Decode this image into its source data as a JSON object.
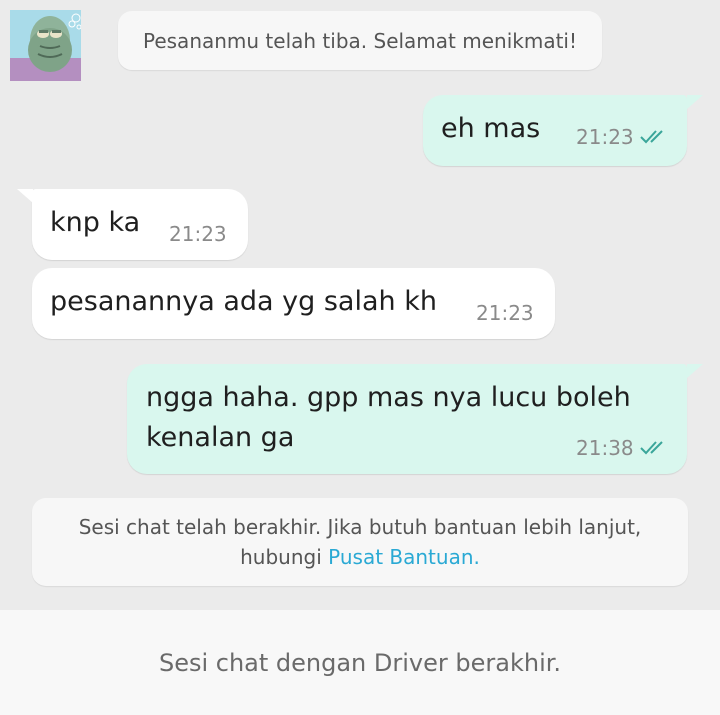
{
  "system_notice": {
    "text": "Pesananmu telah tiba. Selamat menikmati!"
  },
  "avatar": {
    "icon": "fish-character-avatar"
  },
  "messages": [
    {
      "direction": "out",
      "text": "eh mas",
      "time": "21:23",
      "status": "read"
    },
    {
      "direction": "in",
      "text": "knp ka",
      "time": "21:23"
    },
    {
      "direction": "in",
      "text": "pesanannya ada yg salah kh",
      "time": "21:23"
    },
    {
      "direction": "out",
      "text_line1": "ngga haha. gpp mas nya lucu boleh",
      "text_line2": "kenalan ga",
      "time": "21:38",
      "status": "read"
    }
  ],
  "end_notice": {
    "line1": "Sesi chat telah berakhir. Jika butuh bantuan lebih lanjut,",
    "line2_prefix": "hubungi ",
    "link_text": "Pusat Bantuan."
  },
  "footer": {
    "text": "Sesi chat dengan Driver berakhir."
  },
  "colors": {
    "outgoing_bubble": "#d9f7ee",
    "incoming_bubble": "#ffffff",
    "link": "#2aa9d4",
    "read_tick": "#3aa69a"
  }
}
